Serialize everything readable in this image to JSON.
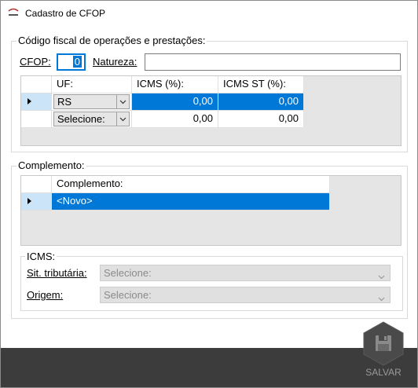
{
  "window": {
    "title": "Cadastro de CFOP",
    "app_icon": "pet-shop-logo-icon",
    "app_icon_text": "PET SHOP"
  },
  "fiscal_group": {
    "legend": "Código fiscal de operações e prestações:",
    "cfop_label": "CFOP:",
    "cfop_value": "0",
    "natureza_label": "Natureza:",
    "natureza_value": "",
    "grid": {
      "columns": [
        "UF:",
        "ICMS (%):",
        "ICMS ST (%):"
      ],
      "rows": [
        {
          "uf": "RS",
          "icms": "0,00",
          "icms_st": "0,00",
          "selected": true
        },
        {
          "uf": "Selecione:",
          "icms": "0,00",
          "icms_st": "0,00",
          "selected": false
        }
      ]
    }
  },
  "complemento_group": {
    "legend": "Complemento:",
    "grid": {
      "columns": [
        "Complemento:"
      ],
      "rows": [
        {
          "complemento": "<Novo>",
          "selected": true
        }
      ]
    },
    "icms_group": {
      "legend": "ICMS:",
      "sit_label": "Sit. tributária:",
      "sit_value": "Selecione:",
      "origem_label": "Origem:",
      "origem_value": "Selecione:"
    }
  },
  "footer": {
    "save_label": "SALVAR",
    "save_icon": "floppy-disk-icon"
  },
  "colors": {
    "selection": "#0078d7",
    "row_indicator": "#cce4f7",
    "footer": "#3c3c3c",
    "disabled_text": "#8a8a8a"
  }
}
